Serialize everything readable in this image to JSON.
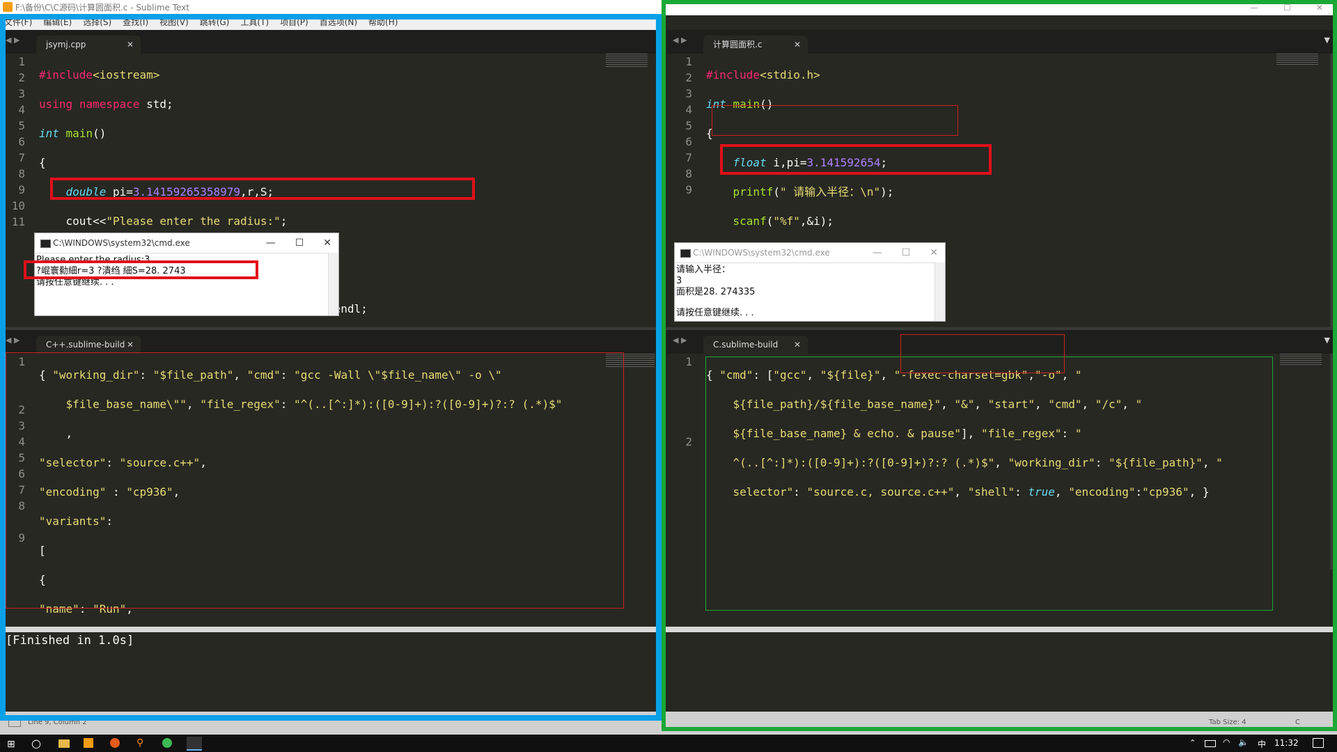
{
  "window": {
    "title": "F:\\备份\\C\\C源码\\计算圆面积.c - Sublime Text"
  },
  "menu": [
    "文件(F)",
    "编辑(E)",
    "选择(S)",
    "查找(I)",
    "视图(V)",
    "跳转(G)",
    "工具(T)",
    "项目(P)",
    "首选项(N)",
    "帮助(H)"
  ],
  "left_top": {
    "tab": "jsymj.cpp",
    "lines": [
      "1",
      "2",
      "3",
      "4",
      "5",
      "6",
      "7",
      "8",
      "9",
      "10",
      "11"
    ]
  },
  "right_top": {
    "tab": "计算圆面积.c",
    "lines": [
      "1",
      "2",
      "3",
      "4",
      "5",
      "6",
      "7",
      "8",
      "9"
    ]
  },
  "left_bottom": {
    "tab": "C++.sublime-build",
    "lines": [
      "1",
      "",
      "",
      "2",
      "3",
      "4",
      "5",
      "6",
      "7",
      "8",
      "",
      "9"
    ]
  },
  "right_bottom": {
    "tab": "C.sublime-build",
    "lines": [
      "1",
      "",
      "",
      "",
      "",
      "2"
    ]
  },
  "cmd_left": {
    "title": "C:\\WINDOWS\\system32\\cmd.exe",
    "lines": [
      "Please enter the radius:3",
      "?崐寰勬細r=3      ?潰绉    細S=28. 2743",
      "请按任意键继续. . ."
    ]
  },
  "cmd_right": {
    "title": "C:\\WINDOWS\\system32\\cmd.exe",
    "lines": [
      "请输入半径：",
      "3",
      "面积是28. 274335",
      "",
      "请按任意键继续. . ."
    ]
  },
  "output": {
    "text": "[Finished in 1.0s]"
  },
  "status": {
    "left": "Line 9, Column 2",
    "tab_size": "Tab Size: 4",
    "syntax": "C"
  },
  "taskbar": {
    "clock": "11:32",
    "ime": "中"
  },
  "colors": {
    "editor_bg": "#272822",
    "blue_box": "#0aa0e8",
    "green_box": "#1aa836",
    "red_box": "#e0101a"
  }
}
